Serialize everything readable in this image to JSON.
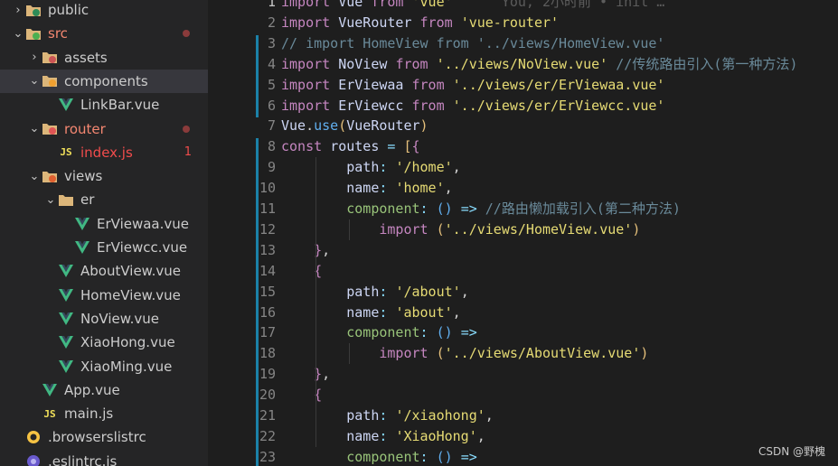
{
  "sidebar": {
    "items": [
      {
        "label": "public",
        "chevron": "›",
        "icon": "folder-public-icon",
        "indent": 0,
        "status": "none"
      },
      {
        "label": "src",
        "chevron": "⌄",
        "icon": "folder-src-icon",
        "indent": 0,
        "status": "modified-dot"
      },
      {
        "label": "assets",
        "chevron": "›",
        "icon": "folder-assets-icon",
        "indent": 1,
        "status": "none"
      },
      {
        "label": "components",
        "chevron": "⌄",
        "icon": "folder-components-icon",
        "indent": 1,
        "status": "none"
      },
      {
        "label": "LinkBar.vue",
        "chevron": "",
        "icon": "vue-file-icon",
        "indent": 2,
        "status": "none"
      },
      {
        "label": "router",
        "chevron": "⌄",
        "icon": "folder-router-icon",
        "indent": 1,
        "status": "modified-dot"
      },
      {
        "label": "index.js",
        "chevron": "",
        "icon": "js-file-icon",
        "indent": 2,
        "status": "error-count",
        "count": "1"
      },
      {
        "label": "views",
        "chevron": "⌄",
        "icon": "folder-views-icon",
        "indent": 1,
        "status": "none"
      },
      {
        "label": "er",
        "chevron": "⌄",
        "icon": "folder-icon",
        "indent": 2,
        "status": "none"
      },
      {
        "label": "ErViewaa.vue",
        "chevron": "",
        "icon": "vue-file-icon",
        "indent": 3,
        "status": "none"
      },
      {
        "label": "ErViewcc.vue",
        "chevron": "",
        "icon": "vue-file-icon",
        "indent": 3,
        "status": "none"
      },
      {
        "label": "AboutView.vue",
        "chevron": "",
        "icon": "vue-file-icon",
        "indent": 2,
        "status": "none"
      },
      {
        "label": "HomeView.vue",
        "chevron": "",
        "icon": "vue-file-icon",
        "indent": 2,
        "status": "none"
      },
      {
        "label": "NoView.vue",
        "chevron": "",
        "icon": "vue-file-icon",
        "indent": 2,
        "status": "none"
      },
      {
        "label": "XiaoHong.vue",
        "chevron": "",
        "icon": "vue-file-icon",
        "indent": 2,
        "status": "none"
      },
      {
        "label": "XiaoMing.vue",
        "chevron": "",
        "icon": "vue-file-icon",
        "indent": 2,
        "status": "none"
      },
      {
        "label": "App.vue",
        "chevron": "",
        "icon": "vue-file-icon",
        "indent": 1,
        "status": "none"
      },
      {
        "label": "main.js",
        "chevron": "",
        "icon": "js-file-icon",
        "indent": 1,
        "status": "none"
      },
      {
        "label": ".browserslistrc",
        "chevron": "",
        "icon": "browserslist-icon",
        "indent": 0,
        "status": "none"
      },
      {
        "label": ".eslintrc.js",
        "chevron": "",
        "icon": "eslint-icon",
        "indent": 0,
        "status": "none"
      }
    ]
  },
  "editor": {
    "current_line": 1,
    "blame": "You, 2小时前 • init …",
    "lines": [
      {
        "n": 1,
        "tokens": [
          [
            "kw",
            "import"
          ],
          [
            "pn",
            " "
          ],
          [
            "id",
            "Vue"
          ],
          [
            "pn",
            " "
          ],
          [
            "kw",
            "from"
          ],
          [
            "pn",
            " "
          ],
          [
            "str",
            "'vue'"
          ]
        ]
      },
      {
        "n": 2,
        "tokens": [
          [
            "kw",
            "import"
          ],
          [
            "pn",
            " "
          ],
          [
            "id",
            "VueRouter"
          ],
          [
            "pn",
            " "
          ],
          [
            "kw",
            "from"
          ],
          [
            "pn",
            " "
          ],
          [
            "str",
            "'vue-router'"
          ]
        ]
      },
      {
        "n": 3,
        "tokens": [
          [
            "cm",
            "// import HomeView from '../views/HomeView.vue'"
          ]
        ]
      },
      {
        "n": 4,
        "tokens": [
          [
            "kw",
            "import"
          ],
          [
            "pn",
            " "
          ],
          [
            "id",
            "NoView"
          ],
          [
            "pn",
            " "
          ],
          [
            "kw",
            "from"
          ],
          [
            "pn",
            " "
          ],
          [
            "str",
            "'../views/NoView.vue'"
          ],
          [
            "pn",
            " "
          ],
          [
            "cm",
            "//传统路由引入(第一种方法)"
          ]
        ]
      },
      {
        "n": 5,
        "tokens": [
          [
            "kw",
            "import"
          ],
          [
            "pn",
            " "
          ],
          [
            "id",
            "ErViewaa"
          ],
          [
            "pn",
            " "
          ],
          [
            "kw",
            "from"
          ],
          [
            "pn",
            " "
          ],
          [
            "str",
            "'../views/er/ErViewaa.vue'"
          ]
        ]
      },
      {
        "n": 6,
        "tokens": [
          [
            "kw",
            "import"
          ],
          [
            "pn",
            " "
          ],
          [
            "id",
            "ErViewcc"
          ],
          [
            "pn",
            " "
          ],
          [
            "kw",
            "from"
          ],
          [
            "pn",
            " "
          ],
          [
            "str",
            "'../views/er/ErViewcc.vue'"
          ]
        ]
      },
      {
        "n": 7,
        "tokens": [
          [
            "id",
            "Vue"
          ],
          [
            "pn",
            "."
          ],
          [
            "fn",
            "use"
          ],
          [
            "br",
            "("
          ],
          [
            "id",
            "VueRouter"
          ],
          [
            "br",
            ")"
          ]
        ]
      },
      {
        "n": 8,
        "tokens": [
          [
            "kw",
            "const"
          ],
          [
            "pn",
            " "
          ],
          [
            "id",
            "routes"
          ],
          [
            "pn",
            " "
          ],
          [
            "pr",
            "="
          ],
          [
            "pn",
            " "
          ],
          [
            "br",
            "["
          ],
          [
            "kw",
            "{"
          ]
        ]
      },
      {
        "n": 9,
        "tokens": [
          [
            "pn",
            "        "
          ],
          [
            "id",
            "path"
          ],
          [
            "pr",
            ":"
          ],
          [
            "pn",
            " "
          ],
          [
            "str",
            "'/home'"
          ],
          [
            "pn",
            ","
          ]
        ]
      },
      {
        "n": 10,
        "tokens": [
          [
            "pn",
            "        "
          ],
          [
            "id",
            "name"
          ],
          [
            "pr",
            ":"
          ],
          [
            "pn",
            " "
          ],
          [
            "str",
            "'home'"
          ],
          [
            "pn",
            ","
          ]
        ]
      },
      {
        "n": 11,
        "tokens": [
          [
            "pn",
            "        "
          ],
          [
            "key",
            "component"
          ],
          [
            "pr",
            ":"
          ],
          [
            "pn",
            " "
          ],
          [
            "fn",
            "()"
          ],
          [
            "pn",
            " "
          ],
          [
            "pr",
            "=>"
          ],
          [
            "pn",
            " "
          ],
          [
            "cm",
            "//路由懒加载引入(第二种方法)"
          ]
        ]
      },
      {
        "n": 12,
        "tokens": [
          [
            "pn",
            "            "
          ],
          [
            "kw",
            "import"
          ],
          [
            "pn",
            " "
          ],
          [
            "br",
            "("
          ],
          [
            "str",
            "'../views/HomeView.vue'"
          ],
          [
            "br",
            ")"
          ]
        ]
      },
      {
        "n": 13,
        "tokens": [
          [
            "pn",
            "    "
          ],
          [
            "kw",
            "}"
          ],
          [
            "pn",
            ","
          ]
        ]
      },
      {
        "n": 14,
        "tokens": [
          [
            "pn",
            "    "
          ],
          [
            "kw",
            "{"
          ]
        ]
      },
      {
        "n": 15,
        "tokens": [
          [
            "pn",
            "        "
          ],
          [
            "id",
            "path"
          ],
          [
            "pr",
            ":"
          ],
          [
            "pn",
            " "
          ],
          [
            "str",
            "'/about'"
          ],
          [
            "pn",
            ","
          ]
        ]
      },
      {
        "n": 16,
        "tokens": [
          [
            "pn",
            "        "
          ],
          [
            "id",
            "name"
          ],
          [
            "pr",
            ":"
          ],
          [
            "pn",
            " "
          ],
          [
            "str",
            "'about'"
          ],
          [
            "pn",
            ","
          ]
        ]
      },
      {
        "n": 17,
        "tokens": [
          [
            "pn",
            "        "
          ],
          [
            "key",
            "component"
          ],
          [
            "pr",
            ":"
          ],
          [
            "pn",
            " "
          ],
          [
            "fn",
            "()"
          ],
          [
            "pn",
            " "
          ],
          [
            "pr",
            "=>"
          ]
        ]
      },
      {
        "n": 18,
        "tokens": [
          [
            "pn",
            "            "
          ],
          [
            "kw",
            "import"
          ],
          [
            "pn",
            " "
          ],
          [
            "br",
            "("
          ],
          [
            "str",
            "'../views/AboutView.vue'"
          ],
          [
            "br",
            ")"
          ]
        ]
      },
      {
        "n": 19,
        "tokens": [
          [
            "pn",
            "    "
          ],
          [
            "kw",
            "}"
          ],
          [
            "pn",
            ","
          ]
        ]
      },
      {
        "n": 20,
        "tokens": [
          [
            "pn",
            "    "
          ],
          [
            "kw",
            "{"
          ]
        ]
      },
      {
        "n": 21,
        "tokens": [
          [
            "pn",
            "        "
          ],
          [
            "id",
            "path"
          ],
          [
            "pr",
            ":"
          ],
          [
            "pn",
            " "
          ],
          [
            "str",
            "'/xiaohong'"
          ],
          [
            "pn",
            ","
          ]
        ]
      },
      {
        "n": 22,
        "tokens": [
          [
            "pn",
            "        "
          ],
          [
            "id",
            "name"
          ],
          [
            "pr",
            ":"
          ],
          [
            "pn",
            " "
          ],
          [
            "str",
            "'XiaoHong'"
          ],
          [
            "pn",
            ","
          ]
        ]
      },
      {
        "n": 23,
        "tokens": [
          [
            "pn",
            "        "
          ],
          [
            "key",
            "component"
          ],
          [
            "pr",
            ":"
          ],
          [
            "pn",
            " "
          ],
          [
            "fn",
            "()"
          ],
          [
            "pn",
            " "
          ],
          [
            "pr",
            "=>"
          ]
        ]
      }
    ]
  },
  "watermark": "CSDN @野槐",
  "colors": {
    "vue": "#41b883",
    "js": "#f1e05a",
    "folder": "#dcb67a",
    "modified": "#f48771",
    "error": "#f14c4c"
  }
}
